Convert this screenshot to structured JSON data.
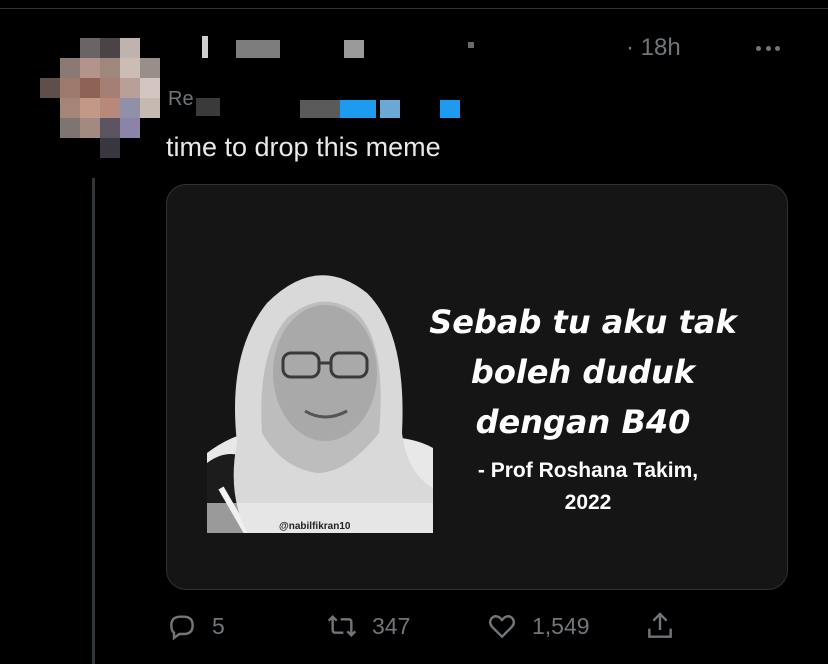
{
  "tweet": {
    "timestamp": "· 18h",
    "reply_prefix": "Re",
    "text": "time to drop this meme"
  },
  "media": {
    "quote_lines": [
      "Sebab tu aku tak",
      "boleh duduk",
      "dengan B40"
    ],
    "attribution_lines": [
      "- Prof Roshana Takim,",
      "2022"
    ],
    "watermark": "@nabilfikran10"
  },
  "actions": {
    "reply_count": "5",
    "retweet_count": "347",
    "like_count": "1,549"
  },
  "colors": {
    "background": "#000000",
    "muted": "#71767b",
    "text": "#e7e9ea",
    "link_blue": "#1d9bf0"
  },
  "icons": {
    "reply": "speech-bubble-icon",
    "retweet": "retweet-arrows-icon",
    "like": "heart-icon",
    "share": "share-upload-icon",
    "more": "ellipsis-icon"
  }
}
